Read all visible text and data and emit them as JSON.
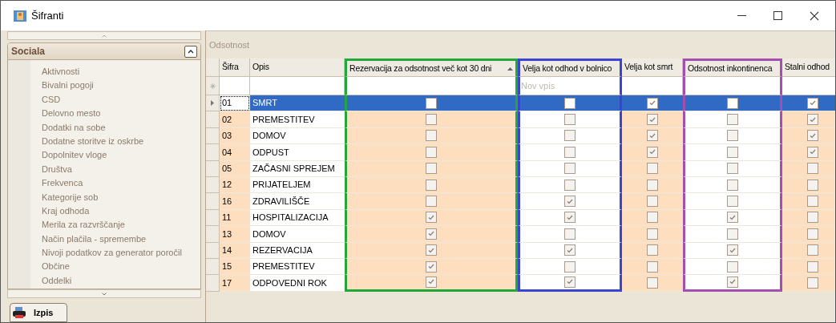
{
  "window": {
    "title": "Šifranti"
  },
  "sidebar": {
    "group": "Sociala",
    "expanded": true,
    "items": [
      "Aktivnosti",
      "Bivalni pogoji",
      "CSD",
      "Delovno mesto",
      "Dodatki na sobe",
      "Dodatne storitve iz oskrbe",
      "Dopolnitev vloge",
      "Društva",
      "Frekvenca",
      "Kategorije sob",
      "Kraj odhoda",
      "Merila za razvrščanje",
      "Način plačila - spremembe",
      "Nivoji podatkov za generator poročil",
      "Občine",
      "Oddelki"
    ]
  },
  "print_button": "Izpis",
  "grid": {
    "title": "Odsotnost",
    "new_row_placeholder": "Nov vpis",
    "columns": [
      {
        "label": "Šifra",
        "shaded": true
      },
      {
        "label": "Opis",
        "shaded": false
      },
      {
        "label": "Rezervacija za odsotnost več kot 30 dni",
        "shaded": true,
        "sorted": true,
        "color": "#22a83a"
      },
      {
        "label": "Velja kot odhod v bolnico",
        "shaded": false,
        "sorted": false,
        "color": "#3a44d0"
      },
      {
        "label": "Velja kot smrt",
        "shaded": true,
        "sorted": false
      },
      {
        "label": "Odsotnost inkontinenca",
        "shaded": false,
        "sorted": false,
        "color": "#a24fb0"
      },
      {
        "label": "Stalni odhod",
        "shaded": true,
        "sorted": false
      }
    ],
    "rows": [
      {
        "cells": [
          "01",
          "SMRT"
        ],
        "checks": [
          false,
          false,
          true,
          false,
          true
        ],
        "selected": true
      },
      {
        "cells": [
          "02",
          "PREMESTITEV"
        ],
        "checks": [
          false,
          false,
          true,
          false,
          true
        ],
        "selected": false
      },
      {
        "cells": [
          "03",
          "DOMOV"
        ],
        "checks": [
          false,
          false,
          true,
          false,
          true
        ],
        "selected": false
      },
      {
        "cells": [
          "04",
          "ODPUST"
        ],
        "checks": [
          false,
          false,
          true,
          false,
          true
        ],
        "selected": false
      },
      {
        "cells": [
          "05",
          "ZAČASNI SPREJEM"
        ],
        "checks": [
          false,
          false,
          false,
          false,
          false
        ],
        "selected": false
      },
      {
        "cells": [
          "12",
          "PRIJATELJEM"
        ],
        "checks": [
          false,
          false,
          false,
          false,
          false
        ],
        "selected": false
      },
      {
        "cells": [
          "16",
          "ZDRAVILIŠČE"
        ],
        "checks": [
          false,
          true,
          false,
          false,
          false
        ],
        "selected": false
      },
      {
        "cells": [
          "11",
          "HOSPITALIZACIJA"
        ],
        "checks": [
          true,
          true,
          false,
          true,
          false
        ],
        "selected": false
      },
      {
        "cells": [
          "13",
          "DOMOV"
        ],
        "checks": [
          true,
          false,
          false,
          false,
          false
        ],
        "selected": false
      },
      {
        "cells": [
          "14",
          "REZERVACIJA"
        ],
        "checks": [
          true,
          true,
          false,
          true,
          false
        ],
        "selected": false
      },
      {
        "cells": [
          "15",
          "PREMESTITEV"
        ],
        "checks": [
          true,
          false,
          false,
          false,
          false
        ],
        "selected": false
      },
      {
        "cells": [
          "17",
          "ODPOVEDNI ROK"
        ],
        "checks": [
          true,
          true,
          false,
          true,
          false
        ],
        "selected": false
      }
    ]
  }
}
